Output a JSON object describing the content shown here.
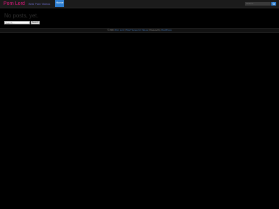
{
  "header": {
    "site_title": "Porn Lord",
    "tagline": "Best Porn Videos",
    "nav_home": "Home",
    "search_placeholder": "Search..."
  },
  "main": {
    "no_posts_message": "No posts, yet.",
    "search_placeholder": "Search ...",
    "search_button": "Search"
  },
  "footer": {
    "prefix": "© 2021",
    "site_link": "Porn Lord",
    "separator_1": "|",
    "theme_link": "Pika Themes for Videos",
    "separator_2": "|",
    "powered_text": "Powered by",
    "wordpress_link": "WordPress"
  },
  "colors": {
    "background": "#000000",
    "topbar": "#1b1b1b",
    "title": "#e0177d",
    "tagline": "#6f6fd0",
    "accent": "#2f7fd1",
    "footer_link": "#4a7fc1"
  }
}
